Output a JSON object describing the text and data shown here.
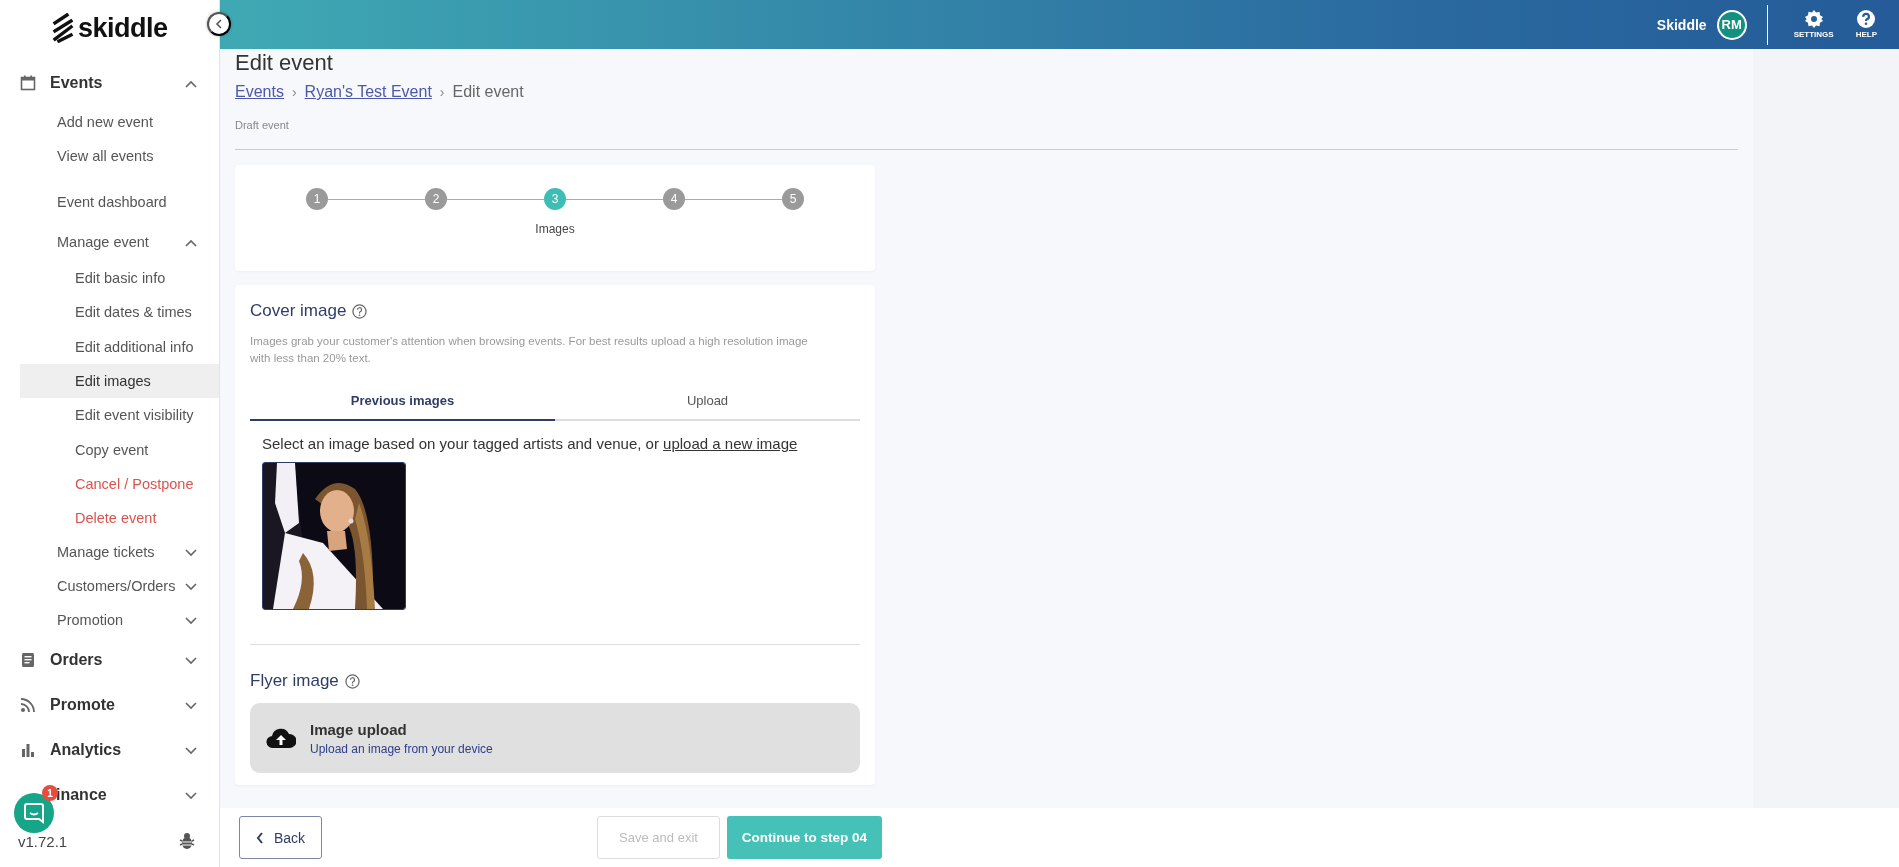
{
  "topbar": {
    "user": "Skiddle",
    "avatar": "RM",
    "actions": [
      {
        "kind": "settings",
        "label": "SETTINGS"
      },
      {
        "kind": "help",
        "label": "HELP"
      }
    ]
  },
  "sidebar": {
    "logo": "skiddle",
    "nav": [
      {
        "label": "Events",
        "expanded": true,
        "children": [
          {
            "label": "Add new event",
            "kind": "normal",
            "selected": false
          },
          {
            "label": "View all events",
            "kind": "normal",
            "selected": false
          },
          {
            "label": "Event dashboard",
            "kind": "normal",
            "selected": false
          },
          {
            "label": "Manage event",
            "kind": "normal",
            "selected": false,
            "expanded": true,
            "children": [
              {
                "label": "Edit basic info",
                "kind": "normal",
                "selected": false
              },
              {
                "label": "Edit dates & times",
                "kind": "normal",
                "selected": false
              },
              {
                "label": "Edit additional info",
                "kind": "normal",
                "selected": false
              },
              {
                "label": "Edit images",
                "kind": "normal",
                "selected": true
              },
              {
                "label": "Edit event visibility",
                "kind": "normal",
                "selected": false
              },
              {
                "label": "Copy event",
                "kind": "normal",
                "selected": false
              },
              {
                "label": "Cancel / Postpone",
                "kind": "danger",
                "selected": false
              },
              {
                "label": "Delete event",
                "kind": "danger",
                "selected": false
              }
            ]
          },
          {
            "label": "Manage tickets",
            "kind": "normal",
            "selected": false,
            "expanded": false
          },
          {
            "label": "Customers/Orders",
            "kind": "normal",
            "selected": false,
            "expanded": false
          },
          {
            "label": "Promotion",
            "kind": "normal",
            "selected": false,
            "expanded": false
          }
        ]
      },
      {
        "label": "Orders",
        "expanded": false
      },
      {
        "label": "Promote",
        "expanded": false
      },
      {
        "label": "Analytics",
        "expanded": false
      },
      {
        "label": "inance",
        "expanded": false
      }
    ],
    "chat_badge": "1",
    "version": "v1.72.1"
  },
  "page": {
    "title": "Edit event",
    "breadcrumb": [
      {
        "label": "Events",
        "kind": "link"
      },
      {
        "label": "›",
        "kind": "separator"
      },
      {
        "label": "Ryan's Test Event",
        "kind": "link"
      },
      {
        "label": "›",
        "kind": "separator"
      },
      {
        "label": "Edit event",
        "kind": "current"
      }
    ],
    "status": "Draft event"
  },
  "stepper": {
    "steps": [
      {
        "number": "1",
        "selected": false
      },
      {
        "number": "2",
        "selected": false
      },
      {
        "number": "3",
        "selected": true,
        "label": "Images"
      },
      {
        "number": "4",
        "selected": false
      },
      {
        "number": "5",
        "selected": false
      }
    ]
  },
  "cover": {
    "title": "Cover image",
    "hint": "Images grab your customer's attention when browsing events. For best results upload a high resolution image with less than 20% text.",
    "tabs": [
      {
        "label": "Previous images",
        "selected": true
      },
      {
        "label": "Upload",
        "selected": false
      }
    ],
    "prompt": "Select an image based on your tagged artists and venue, or ",
    "prompt_link": "upload a new image"
  },
  "flyer": {
    "title": "Flyer image",
    "upload_title": "Image upload",
    "upload_subtitle": "Upload an image from your device"
  },
  "footer": {
    "back": "Back",
    "save": {
      "label": "Save and exit",
      "disabled": true
    },
    "continue": "Continue to step 04"
  }
}
